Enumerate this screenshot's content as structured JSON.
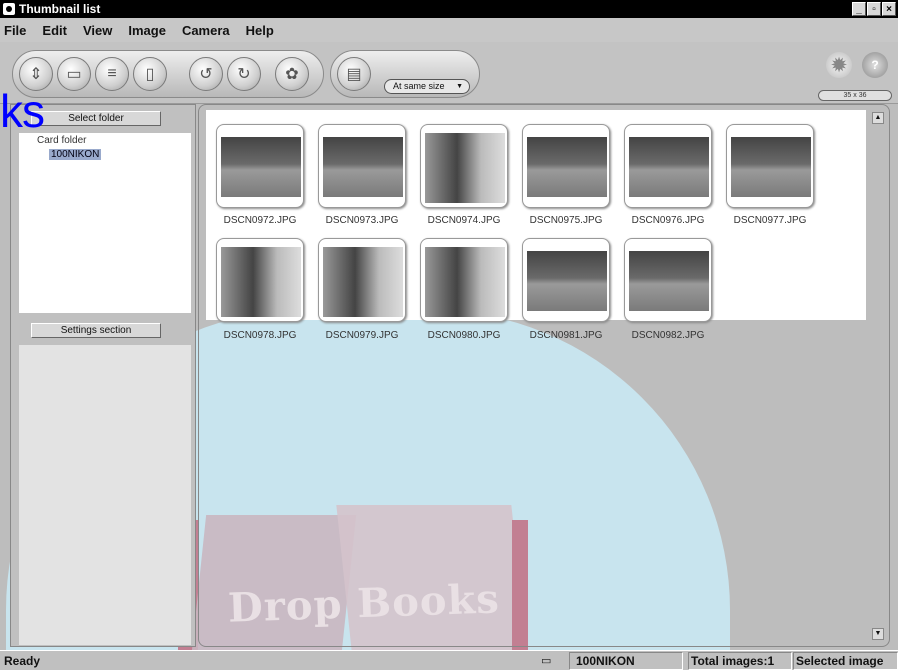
{
  "window": {
    "title": "Thumbnail list",
    "controls": [
      "_",
      "▫",
      "×"
    ]
  },
  "menu": {
    "items": [
      "File",
      "Edit",
      "View",
      "Image",
      "Camera",
      "Help"
    ]
  },
  "toolbar": {
    "icons": [
      "transfer-icon",
      "save-icon",
      "print-icon",
      "delete-icon",
      "rotate-left-icon",
      "rotate-right-icon",
      "unknown-icon",
      "file-icon"
    ],
    "size_select": "At same size",
    "zoom_select": "35 x 36"
  },
  "overlay": {
    "text": "ks"
  },
  "left_panel": {
    "select_folder_label": "Select folder",
    "tree_root": "Card folder",
    "tree_child": "100NIKON",
    "settings_label": "Settings section"
  },
  "thumbnails": [
    {
      "name": "DSCN0972.JPG"
    },
    {
      "name": "DSCN0973.JPG"
    },
    {
      "name": "DSCN0974.JPG"
    },
    {
      "name": "DSCN0975.JPG"
    },
    {
      "name": "DSCN0976.JPG"
    },
    {
      "name": "DSCN0977.JPG"
    },
    {
      "name": "DSCN0978.JPG"
    },
    {
      "name": "DSCN0979.JPG"
    },
    {
      "name": "DSCN0980.JPG"
    },
    {
      "name": "DSCN0981.JPG"
    },
    {
      "name": "DSCN0982.JPG"
    }
  ],
  "watermark": {
    "text": "Drop Books"
  },
  "status": {
    "ready": "Ready",
    "folder": "100NIKON",
    "total": "Total images:1",
    "selected": "Selected image"
  }
}
